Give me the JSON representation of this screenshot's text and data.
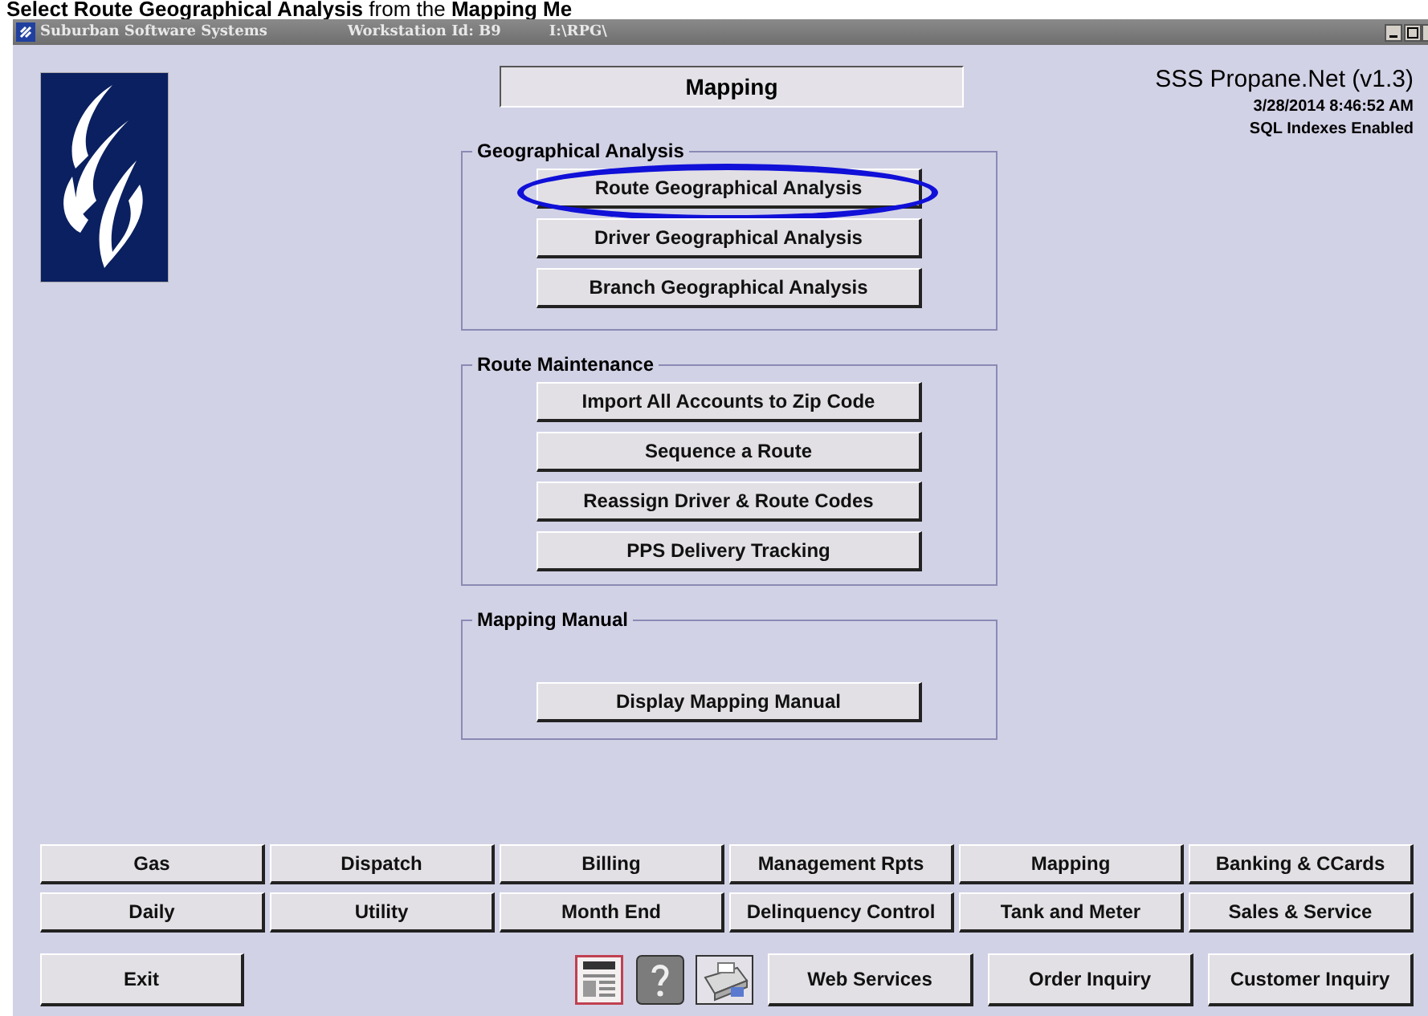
{
  "caption": "**Select Route Geographical Analysis** from the **Mapping Me**",
  "window": {
    "title": "Suburban Software Systems",
    "workstation": "Workstation Id: B9",
    "path": "I:\\RPG\\"
  },
  "screen_title": "Mapping",
  "app_info": {
    "name": "SSS Propane.Net (v1.3)",
    "datetime": "3/28/2014 8:46:52 AM",
    "status": "SQL Indexes Enabled"
  },
  "groups": [
    {
      "title": "Geographical Analysis",
      "buttons": [
        {
          "label": "Route Geographical Analysis",
          "highlighted": true
        },
        {
          "label": "Driver Geographical Analysis",
          "highlighted": false
        },
        {
          "label": "Branch Geographical Analysis",
          "highlighted": false
        }
      ]
    },
    {
      "title": "Route Maintenance",
      "buttons": [
        {
          "label": "Import All Accounts to Zip Code",
          "highlighted": false
        },
        {
          "label": "Sequence a Route",
          "highlighted": false
        },
        {
          "label": "Reassign Driver & Route Codes",
          "highlighted": false
        },
        {
          "label": "PPS Delivery Tracking",
          "highlighted": false
        }
      ]
    },
    {
      "title": "Mapping Manual",
      "buttons": [
        {
          "label": "Display Mapping Manual",
          "highlighted": false
        }
      ]
    }
  ],
  "menu_buttons": [
    "Gas",
    "Dispatch",
    "Billing",
    "Management Rpts",
    "Mapping",
    "Banking & CCards",
    "Daily",
    "Utility",
    "Month End",
    "Delinquency Control",
    "Tank and Meter",
    "Sales & Service"
  ],
  "bottom_bar": [
    {
      "kind": "button",
      "label": "Exit"
    },
    {
      "kind": "spacer"
    },
    {
      "kind": "news"
    },
    {
      "kind": "help"
    },
    {
      "kind": "print"
    },
    {
      "kind": "button",
      "label": "Web Services"
    },
    {
      "kind": "button",
      "label": "Order Inquiry"
    },
    {
      "kind": "button",
      "label": "Customer Inquiry"
    }
  ]
}
